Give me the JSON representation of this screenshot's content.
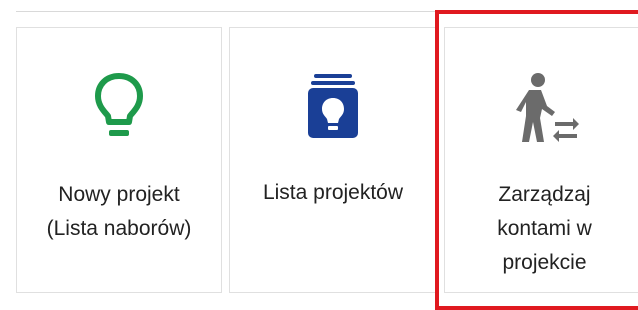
{
  "tiles": [
    {
      "label": "Nowy projekt\n(Lista naborów)",
      "icon": "lightbulb-icon",
      "icon_color": "#1e9a4b"
    },
    {
      "label": "Lista projektów",
      "icon": "project-list-icon",
      "icon_color": "#1a3f96"
    },
    {
      "label": "Zarządzaj\nkontami w\nprojekcie",
      "icon": "person-exchange-icon",
      "icon_color": "#6b6b6b"
    }
  ],
  "highlight_color": "#e0191f"
}
